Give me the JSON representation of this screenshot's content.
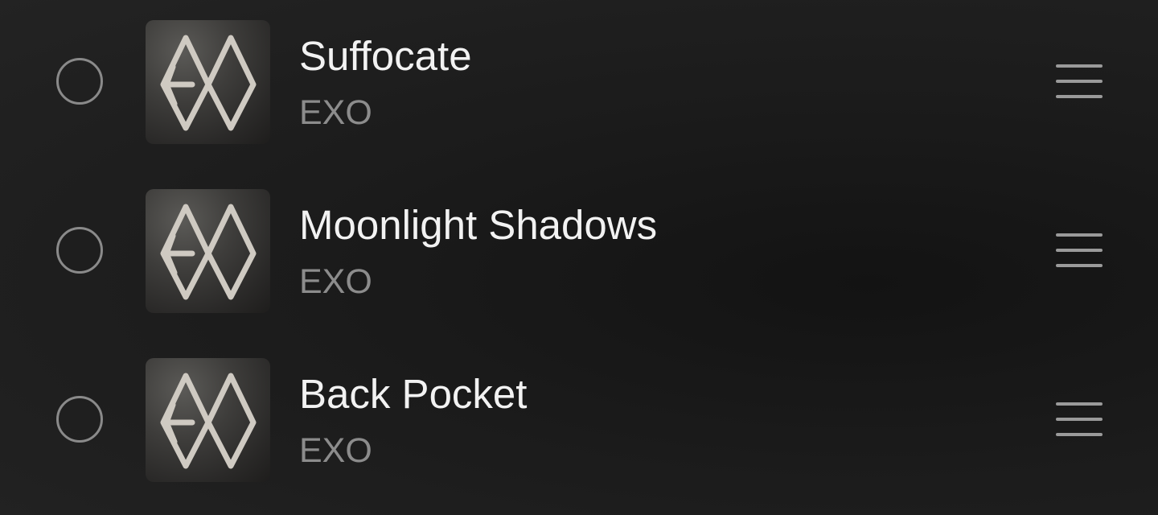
{
  "songs": [
    {
      "title": "Suffocate",
      "artist": "EXO",
      "album_art_icon": "exo-logo-art"
    },
    {
      "title": "Moonlight Shadows",
      "artist": "EXO",
      "album_art_icon": "exo-logo-art"
    },
    {
      "title": "Back Pocket",
      "artist": "EXO",
      "album_art_icon": "exo-logo-art"
    }
  ],
  "colors": {
    "background": "#1b1b1b",
    "title_text": "#f2f2f2",
    "artist_text": "#8c8c8c",
    "control_gray": "#8a8a8a"
  }
}
